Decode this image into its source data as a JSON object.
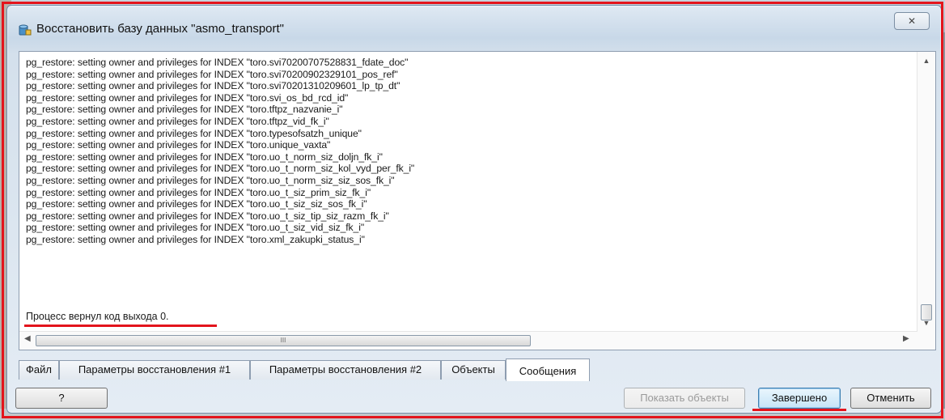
{
  "window": {
    "title": "Восстановить базу данных \"asmo_transport\"",
    "close_label": "✕"
  },
  "log": {
    "lines": [
      "pg_restore: setting owner and privileges for INDEX \"toro.svi70200707528831_fdate_doc\"",
      "pg_restore: setting owner and privileges for INDEX \"toro.svi70200902329101_pos_ref\"",
      "pg_restore: setting owner and privileges for INDEX \"toro.svi70201310209601_lp_tp_dt\"",
      "pg_restore: setting owner and privileges for INDEX \"toro.svi_os_bd_rcd_id\"",
      "pg_restore: setting owner and privileges for INDEX \"toro.tftpz_nazvanie_i\"",
      "pg_restore: setting owner and privileges for INDEX \"toro.tftpz_vid_fk_i\"",
      "pg_restore: setting owner and privileges for INDEX \"toro.typesofsatzh_unique\"",
      "pg_restore: setting owner and privileges for INDEX \"toro.unique_vaxta\"",
      "pg_restore: setting owner and privileges for INDEX \"toro.uo_t_norm_siz_doljn_fk_i\"",
      "pg_restore: setting owner and privileges for INDEX \"toro.uo_t_norm_siz_kol_vyd_per_fk_i\"",
      "pg_restore: setting owner and privileges for INDEX \"toro.uo_t_norm_siz_siz_sos_fk_i\"",
      "pg_restore: setting owner and privileges for INDEX \"toro.uo_t_siz_prim_siz_fk_i\"",
      "pg_restore: setting owner and privileges for INDEX \"toro.uo_t_siz_siz_sos_fk_i\"",
      "pg_restore: setting owner and privileges for INDEX \"toro.uo_t_siz_tip_siz_razm_fk_i\"",
      "pg_restore: setting owner and privileges for INDEX \"toro.uo_t_siz_vid_siz_fk_i\"",
      "pg_restore: setting owner and privileges for INDEX \"toro.xml_zakupki_status_i\""
    ],
    "exit_message": "Процесс вернул код выхода 0."
  },
  "scroll": {
    "up": "▲",
    "down": "▼",
    "left": "◀",
    "right": "▶",
    "grip": "III"
  },
  "tabs": [
    {
      "label": "Файл"
    },
    {
      "label": "Параметры восстановления #1"
    },
    {
      "label": "Параметры восстановления #2"
    },
    {
      "label": "Объекты"
    },
    {
      "label": "Сообщения"
    }
  ],
  "buttons": {
    "help": "?",
    "show_objects": "Показать объекты",
    "done": "Завершено",
    "cancel": "Отменить"
  },
  "colors": {
    "annotation": "#e3141c"
  }
}
